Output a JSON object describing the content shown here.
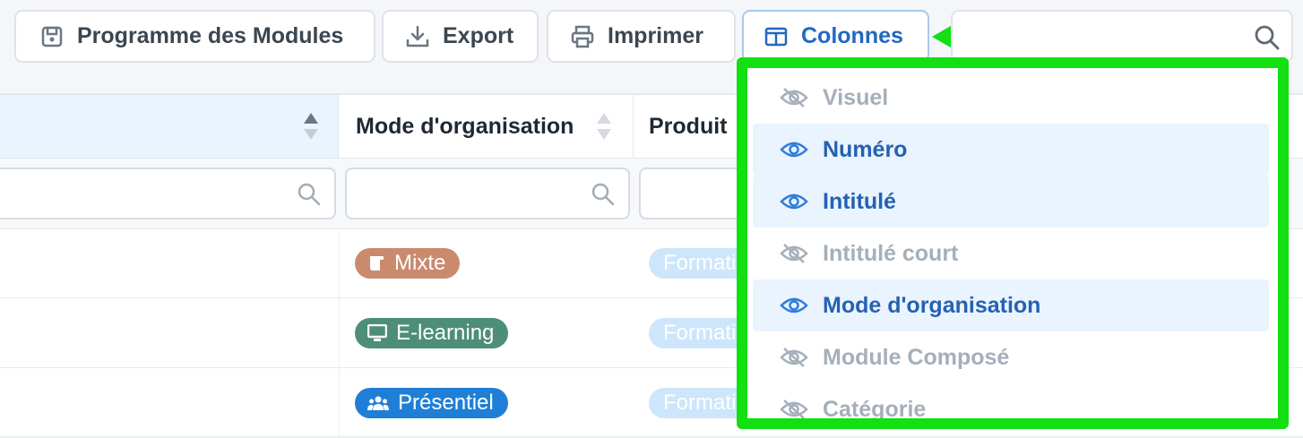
{
  "toolbar": {
    "programme_label": "Programme des Modules",
    "export_label": "Export",
    "print_label": "Imprimer",
    "columns_label": "Colonnes"
  },
  "search": {
    "placeholder": ""
  },
  "table": {
    "headers": [
      "",
      "Mode d'organisation",
      "Produit"
    ],
    "rows": [
      {
        "mode": "Mixte",
        "mode_color": "#c98a6e",
        "mode_icon": "scroll-icon",
        "product": "Formation"
      },
      {
        "mode": "E-learning",
        "mode_color": "#4d8e78",
        "mode_icon": "monitor-icon",
        "product": "Formation"
      },
      {
        "mode": "Présentiel",
        "mode_color": "#1f7fd6",
        "mode_icon": "group-icon",
        "product": "Formation"
      }
    ]
  },
  "columns_menu": {
    "items": [
      {
        "label": "Visuel",
        "visible": false
      },
      {
        "label": "Numéro",
        "visible": true
      },
      {
        "label": "Intitulé",
        "visible": true
      },
      {
        "label": "Intitulé court",
        "visible": false
      },
      {
        "label": "Mode d'organisation",
        "visible": true
      },
      {
        "label": "Module Composé",
        "visible": false
      },
      {
        "label": "Catégorie",
        "visible": false
      }
    ]
  },
  "colors": {
    "highlight": "#12e012",
    "accent": "#2467c1"
  }
}
